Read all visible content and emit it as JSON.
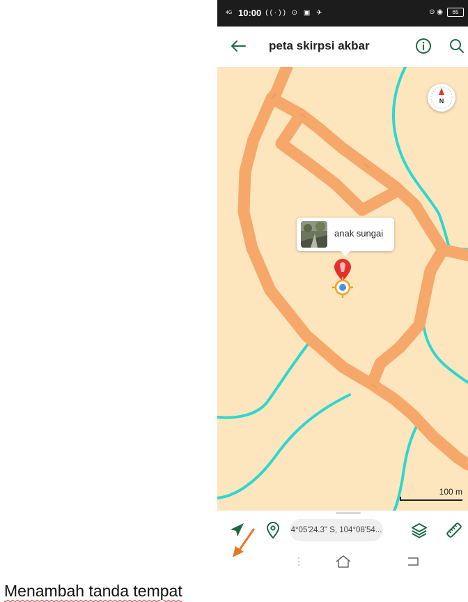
{
  "status_bar": {
    "network": "4G",
    "time": "10:00",
    "left_icons": "((·)) ⊙ ▣ ✈",
    "right_icons": "⊙ ◉",
    "battery": "65"
  },
  "app_bar": {
    "title": "peta skirpsi akbar"
  },
  "map": {
    "compass_label": "N",
    "marker_popup_label": "anak sungai",
    "scale_label": "100 m"
  },
  "bottom_bar": {
    "coordinates": "4°05'24.3\" S, 104°08'54..."
  },
  "caption": "Menambah tanda tempat",
  "colors": {
    "map_background": "#fde6be",
    "road": "#f6a86a",
    "river": "#2fd6cf",
    "accent_green": "#1d6b45",
    "pin_red": "#e5312b",
    "target_orange": "#f2a31b",
    "location_blue": "#4a90e2",
    "arrow_orange": "#e87722"
  }
}
